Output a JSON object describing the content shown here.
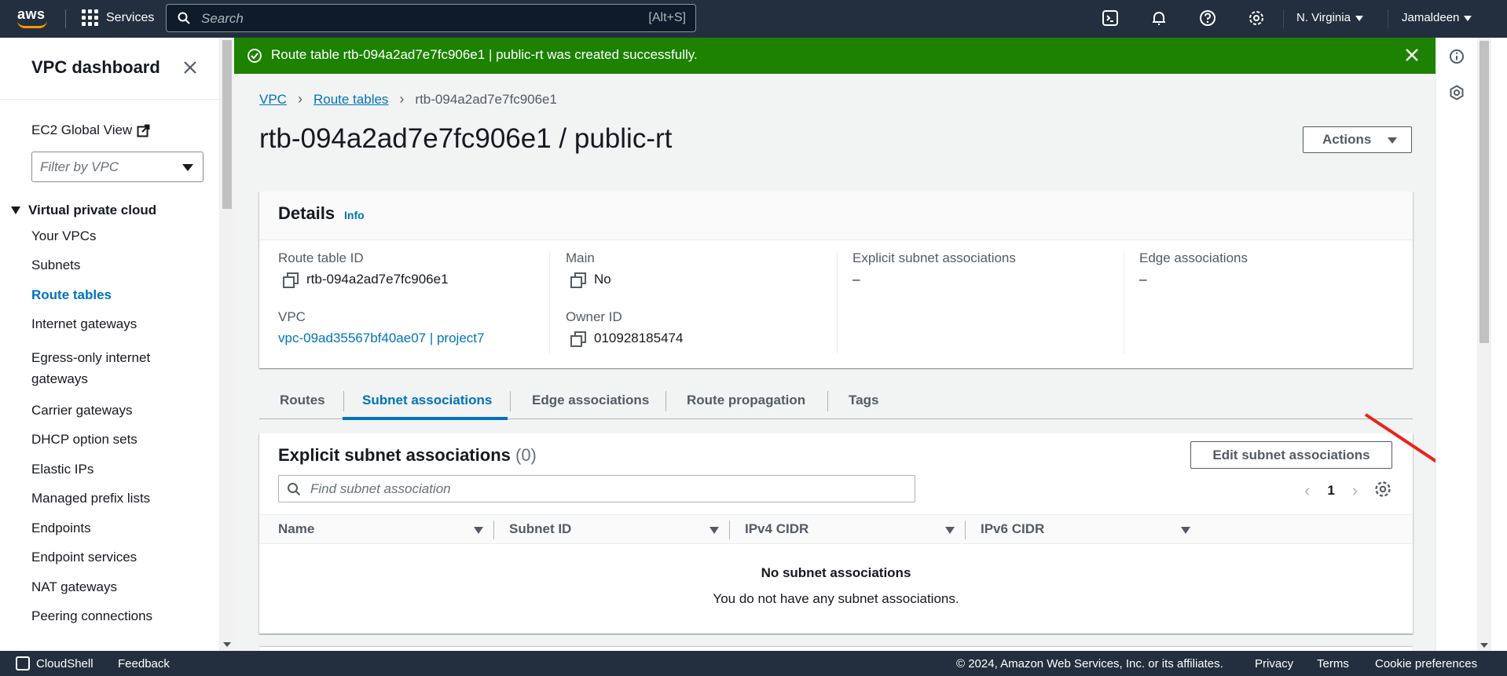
{
  "topnav": {
    "logo_text": "aws",
    "services_label": "Services",
    "search_placeholder": "Search",
    "search_shortcut": "[Alt+S]",
    "region": "N. Virginia",
    "user": "Jamaldeen"
  },
  "sidebar": {
    "title": "VPC dashboard",
    "ec2_global_view": "EC2 Global View",
    "filter_placeholder": "Filter by VPC",
    "section": "Virtual private cloud",
    "items": [
      {
        "label": "Your VPCs"
      },
      {
        "label": "Subnets"
      },
      {
        "label": "Route tables",
        "active": true
      },
      {
        "label": "Internet gateways"
      },
      {
        "label": "Egress-only internet gateways"
      },
      {
        "label": "Carrier gateways"
      },
      {
        "label": "DHCP option sets"
      },
      {
        "label": "Elastic IPs"
      },
      {
        "label": "Managed prefix lists"
      },
      {
        "label": "Endpoints"
      },
      {
        "label": "Endpoint services"
      },
      {
        "label": "NAT gateways"
      },
      {
        "label": "Peering connections"
      }
    ]
  },
  "flash": {
    "message": "Route table rtb-094a2ad7e7fc906e1 | public-rt was created successfully.",
    "color": "#1d8102"
  },
  "breadcrumb": {
    "vpc": "VPC",
    "route_tables": "Route tables",
    "current": "rtb-094a2ad7e7fc906e1"
  },
  "page": {
    "title": "rtb-094a2ad7e7fc906e1 / public-rt",
    "actions_label": "Actions"
  },
  "details": {
    "title": "Details",
    "info_label": "Info",
    "route_table_id_label": "Route table ID",
    "route_table_id": "rtb-094a2ad7e7fc906e1",
    "main_label": "Main",
    "main_value": "No",
    "explicit_label": "Explicit subnet associations",
    "explicit_value": "–",
    "edge_label": "Edge associations",
    "edge_value": "–",
    "vpc_label": "VPC",
    "vpc_value": "vpc-09ad35567bf40ae07 | project7",
    "owner_label": "Owner ID",
    "owner_value": "010928185474"
  },
  "tabs": [
    {
      "label": "Routes"
    },
    {
      "label": "Subnet associations",
      "active": true
    },
    {
      "label": "Edge associations"
    },
    {
      "label": "Route propagation"
    },
    {
      "label": "Tags"
    }
  ],
  "associations": {
    "title": "Explicit subnet associations",
    "count": "(0)",
    "edit_button": "Edit subnet associations",
    "find_placeholder": "Find subnet association",
    "page": "1",
    "columns": [
      "Name",
      "Subnet ID",
      "IPv4 CIDR",
      "IPv6 CIDR"
    ],
    "empty_title": "No subnet associations",
    "empty_sub": "You do not have any subnet associations."
  },
  "footer": {
    "cloudshell": "CloudShell",
    "feedback": "Feedback",
    "copyright": "© 2024, Amazon Web Services, Inc. or its affiliates.",
    "privacy": "Privacy",
    "terms": "Terms",
    "cookie": "Cookie preferences"
  },
  "colors": {
    "nav_bg": "#232f3e",
    "link": "#0073bb",
    "success": "#1d8102",
    "annotation_arrow": "#e8231f"
  }
}
